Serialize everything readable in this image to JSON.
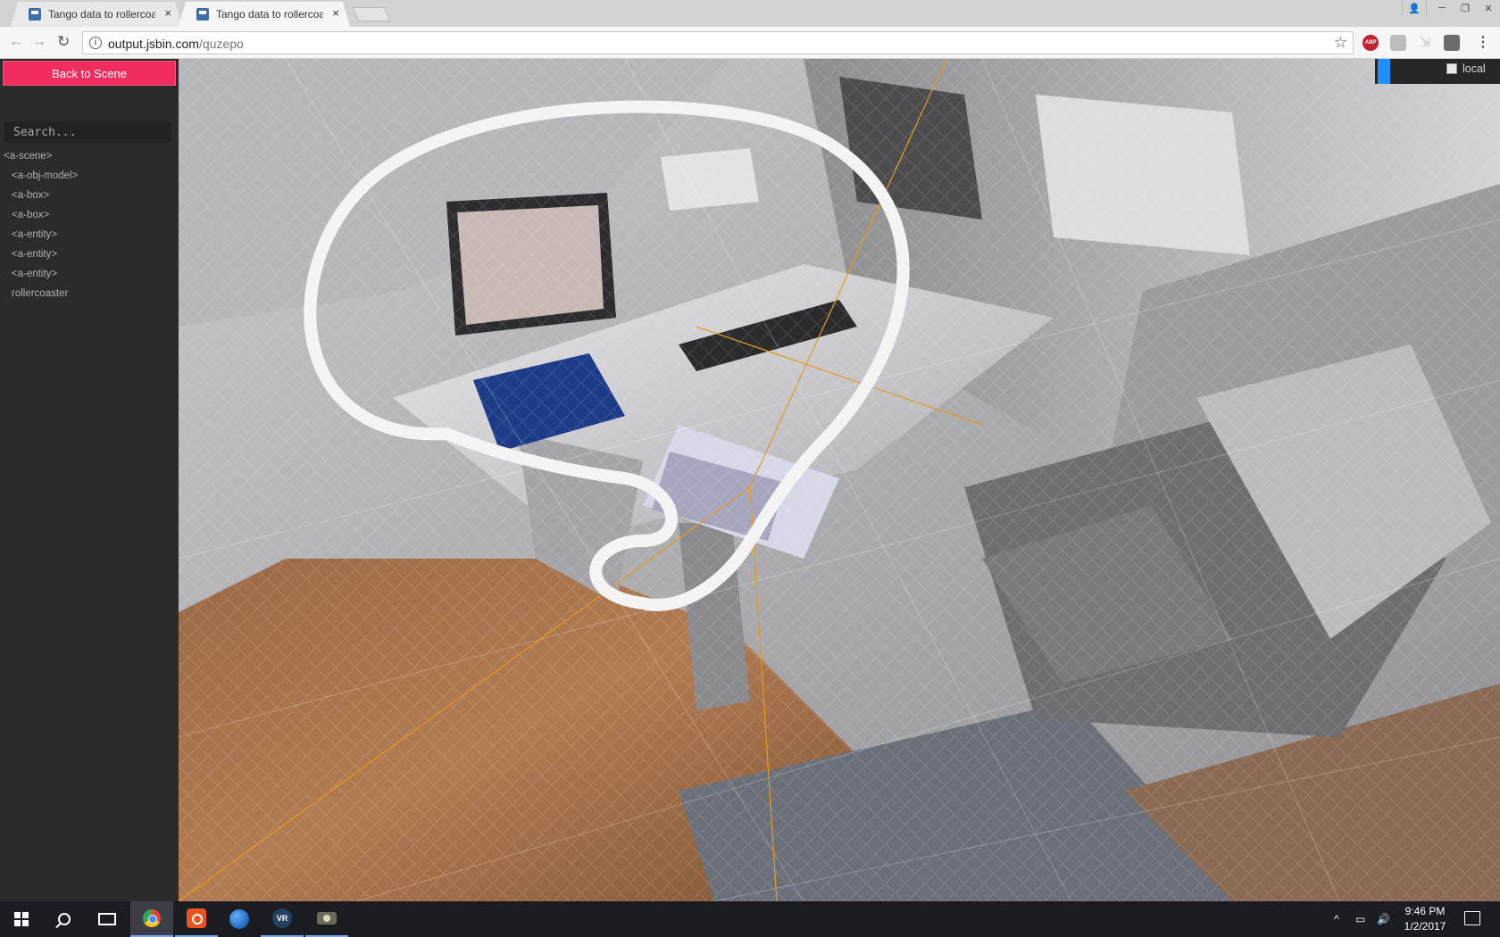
{
  "browser": {
    "tabs": [
      {
        "title": "Tango data to rollercoast",
        "active": false
      },
      {
        "title": "Tango data to rollercoast",
        "active": true
      }
    ],
    "tab_close_icon": "×",
    "address": {
      "host": "output.jsbin.com",
      "path": "/quzepo"
    },
    "extensions": {
      "abp_label": "ABP"
    },
    "window_controls": {
      "profile": "👤",
      "minimize": "─",
      "restore": "❐",
      "close": "✕"
    }
  },
  "inspector": {
    "back_button_label": "Back to Scene",
    "search_placeholder": "Search...",
    "tree": [
      {
        "label": "<a-scene>",
        "level": "root"
      },
      {
        "label": "<a-obj-model>",
        "level": "child"
      },
      {
        "label": "<a-box>",
        "level": "child"
      },
      {
        "label": "<a-box>",
        "level": "child"
      },
      {
        "label": "<a-entity>",
        "level": "child"
      },
      {
        "label": "<a-entity>",
        "level": "child"
      },
      {
        "label": "<a-entity>",
        "level": "child"
      },
      {
        "label": "rollercoaster",
        "level": "child"
      }
    ]
  },
  "viewport": {
    "toggle_label": "local",
    "toggle_checked": false,
    "accent_color": "#1e90ff"
  },
  "taskbar": {
    "apps": [
      "windows-start-icon",
      "search-icon",
      "task-view-icon",
      "chrome-icon",
      "ubuntu-icon",
      "globe-icon",
      "vr-icon",
      "app-icon"
    ],
    "vr_label": "VR",
    "clock": {
      "time": "9:46 PM",
      "date": "1/2/2017"
    }
  },
  "colors": {
    "back_button": "#ef2d5e",
    "sidebar_bg": "#2b2b2b"
  }
}
